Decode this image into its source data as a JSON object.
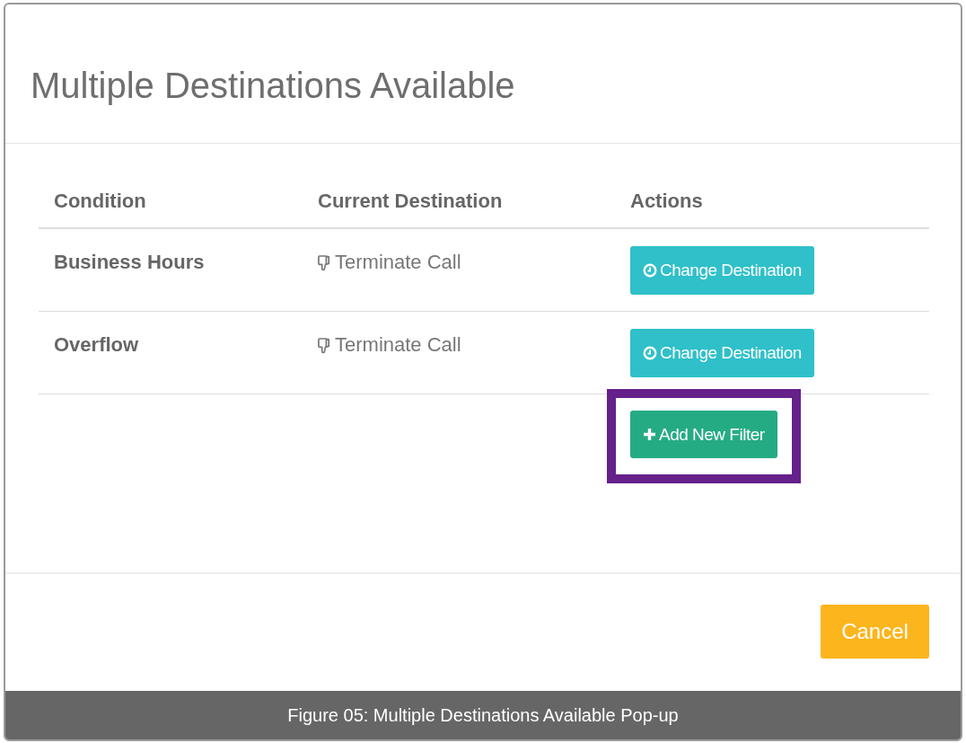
{
  "dialog": {
    "title": "Multiple Destinations Available"
  },
  "table": {
    "columns": [
      "Condition",
      "Current Destination",
      "Actions"
    ],
    "rows": [
      {
        "condition": "Business Hours",
        "destination": "Terminate Call",
        "action": "Change Destination"
      },
      {
        "condition": "Overflow",
        "destination": "Terminate Call",
        "action": "Change Destination"
      }
    ]
  },
  "add_button": {
    "label": "Add New Filter",
    "highlighted": true
  },
  "footer": {
    "buttons": [
      "Cancel"
    ]
  },
  "caption": "Figure 05: Multiple Destinations Available Pop-up"
}
